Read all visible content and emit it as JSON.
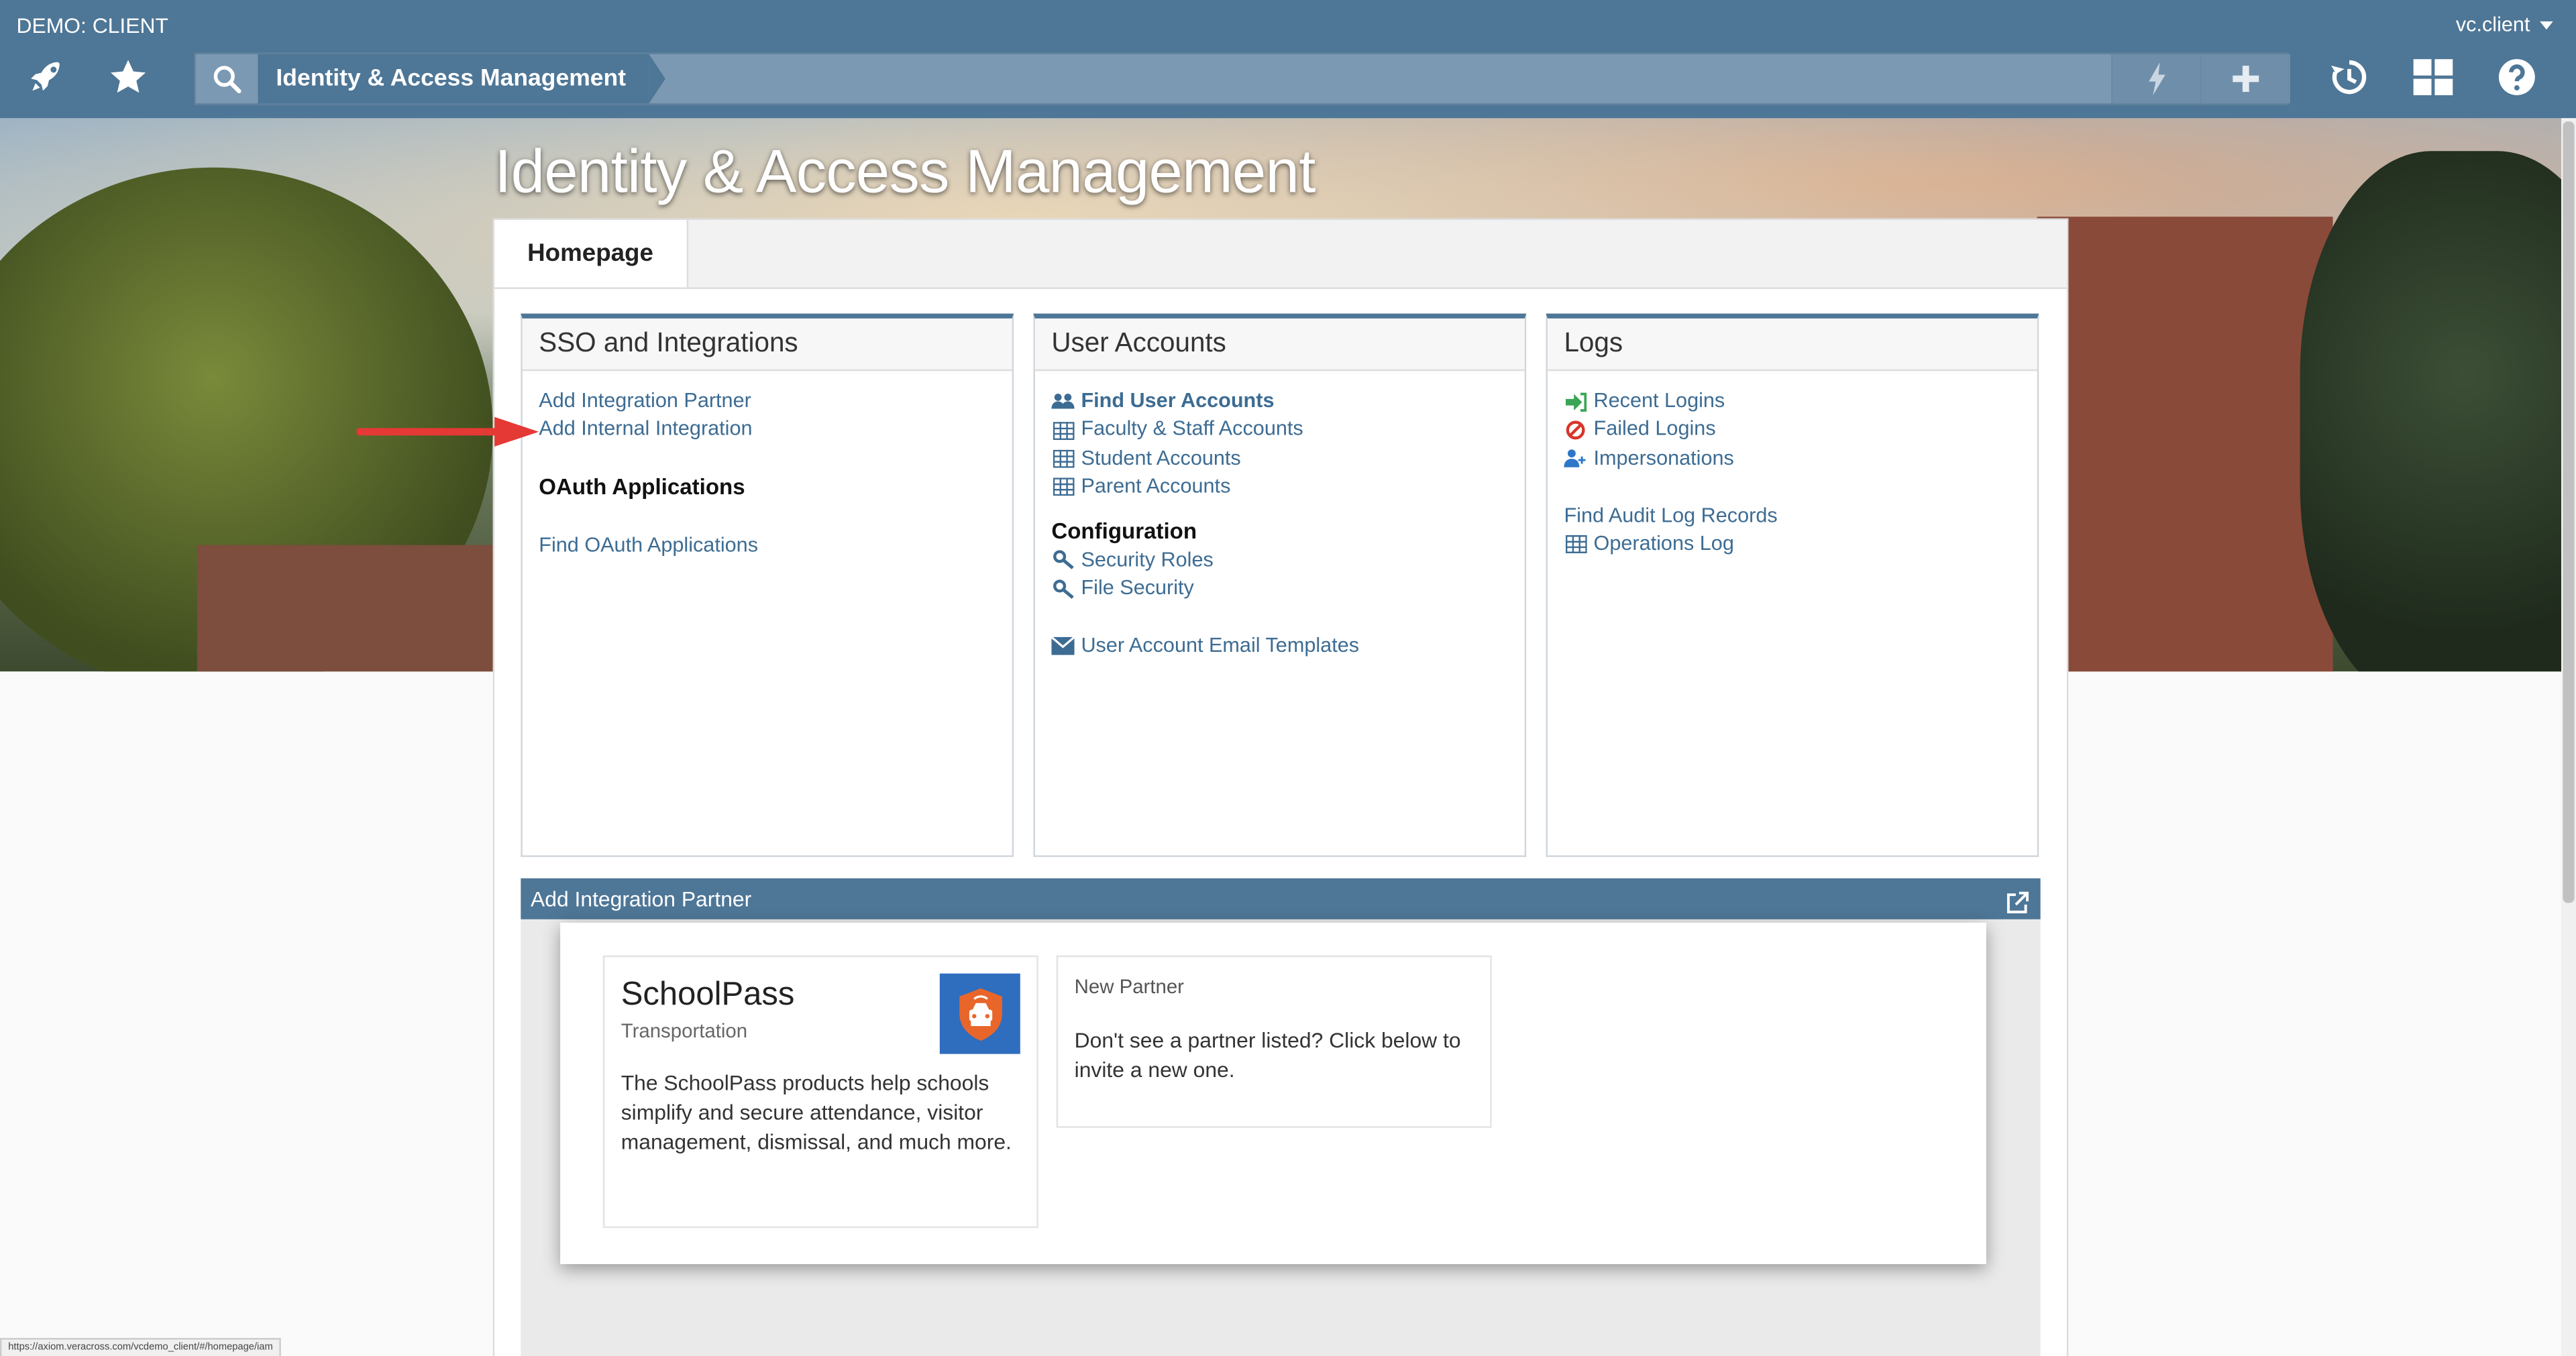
{
  "header": {
    "org_title": "DEMO: CLIENT",
    "user_name": "vc.client",
    "breadcrumb": "Identity & Access Management",
    "left_icons": [
      "rocket-icon",
      "star-icon"
    ],
    "search_tools": [
      "lightning-icon",
      "plus-icon"
    ],
    "right_icons": [
      "history-icon",
      "dashboard-icon",
      "help-icon"
    ]
  },
  "page": {
    "heading": "Identity & Access Management",
    "tabs": [
      {
        "label": "Homepage",
        "active": true
      }
    ]
  },
  "cards": {
    "sso": {
      "title": "SSO and Integrations",
      "links": [
        "Add Integration Partner",
        "Add Internal Integration"
      ],
      "oauth_heading": "OAuth Applications",
      "oauth_links": [
        "Find OAuth Applications"
      ]
    },
    "users": {
      "title": "User Accounts",
      "links": [
        "Find User Accounts",
        "Faculty & Staff Accounts",
        "Student Accounts",
        "Parent Accounts"
      ],
      "config_heading": "Configuration",
      "config_links": [
        "Security Roles",
        "File Security"
      ],
      "email_link": "User Account Email Templates"
    },
    "logs": {
      "title": "Logs",
      "links": [
        "Recent Logins",
        "Failed Logins",
        "Impersonations"
      ],
      "links2": [
        "Find Audit Log Records",
        "Operations Log"
      ]
    }
  },
  "widget": {
    "title": "Add Integration Partner",
    "partner": {
      "name": "SchoolPass",
      "category": "Transportation",
      "description": "The SchoolPass products help schools simplify and secure attendance, visitor management, dismissal, and much more."
    },
    "new_partner": {
      "title": "New Partner",
      "description": "Don't see a partner listed? Click below to invite a new one."
    }
  },
  "status_bar": {
    "url": "https://axiom.veracross.com/vcdemo_client/#/homepage/iam"
  },
  "colors": {
    "header": "#4e7696",
    "link": "#3d6c93",
    "arrow": "#e53935"
  }
}
